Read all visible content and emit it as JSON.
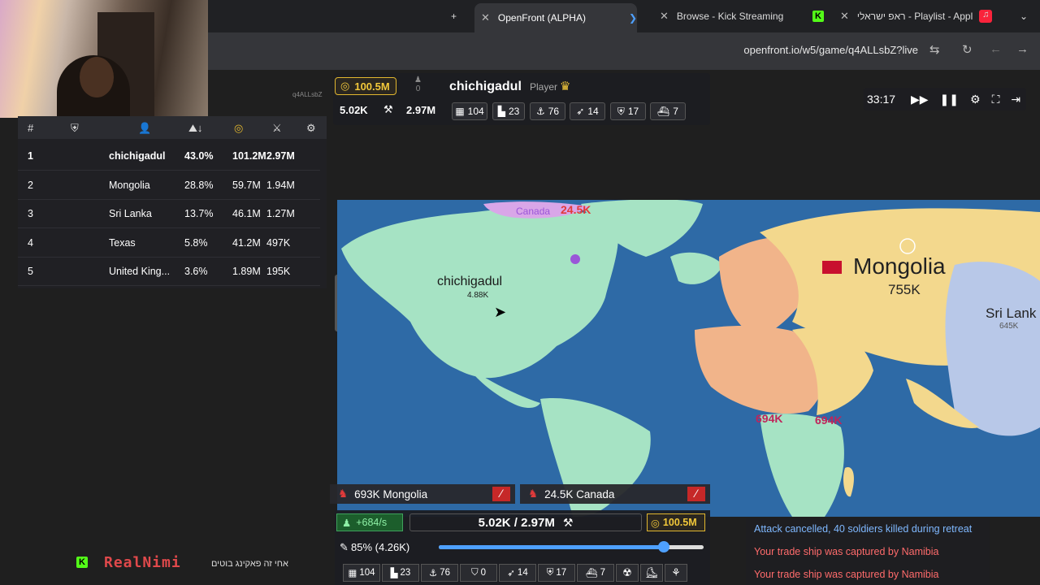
{
  "browser": {
    "tabs": [
      {
        "title": "OpenFront (ALPHA)"
      },
      {
        "title": "Browse - Kick Streaming"
      },
      {
        "title": "ראפ ישראלי - Playlist - Appl"
      }
    ],
    "url": "openfront.io/w5/game/q4ALLsbZ?live"
  },
  "game_id": "q4ALLsbZ",
  "player": {
    "name": "chichigadul",
    "role": "Player",
    "gold": "100.5M",
    "troops": "5.02K",
    "workers": "2.97M",
    "alliances": "0",
    "stats": [
      {
        "icon": "city-icon",
        "value": "104"
      },
      {
        "icon": "factory-icon",
        "value": "23"
      },
      {
        "icon": "port-icon",
        "value": "76"
      },
      {
        "icon": "missile-silo-icon",
        "value": "14"
      },
      {
        "icon": "defense-post-icon",
        "value": "17"
      },
      {
        "icon": "warship-icon",
        "value": "7"
      }
    ]
  },
  "timer": "33:17",
  "leaderboard": {
    "headers": [
      "#",
      "",
      "",
      "",
      "",
      ""
    ],
    "rows": [
      {
        "rank": "1",
        "name": "chichigadul",
        "pct": "43.0%",
        "gold": "101.2M",
        "troops": "2.97M"
      },
      {
        "rank": "2",
        "name": "Mongolia",
        "pct": "28.8%",
        "gold": "59.7M",
        "troops": "1.94M"
      },
      {
        "rank": "3",
        "name": "Sri Lanka",
        "pct": "13.7%",
        "gold": "46.1M",
        "troops": "1.27M"
      },
      {
        "rank": "4",
        "name": "Texas",
        "pct": "5.8%",
        "gold": "41.2M",
        "troops": "497K"
      },
      {
        "rank": "5",
        "name": "United King...",
        "pct": "3.6%",
        "gold": "1.89M",
        "troops": "195K"
      }
    ]
  },
  "map": {
    "labels": {
      "player": "chichigadul",
      "player_troops": "4.88K",
      "mongolia": "Mongolia",
      "mongolia_troops": "755K",
      "srilanka": "Sri Lank",
      "srilanka_troops": "645K",
      "canada": "Canada",
      "canada_troops": "24.5K",
      "africa_a": "694K",
      "africa_b": "694K"
    }
  },
  "attacks": [
    {
      "text": "693K Mongolia"
    },
    {
      "text": "24.5K Canada"
    }
  ],
  "bottom": {
    "rate": "+684/s",
    "troops_ratio": "5.02K / 2.97M",
    "gold": "100.5M",
    "attack_ratio": "85% (4.26K)",
    "slider_fraction": 0.85,
    "build": [
      {
        "icon": "city-icon",
        "value": "104"
      },
      {
        "icon": "factory-icon",
        "value": "23"
      },
      {
        "icon": "port-icon",
        "value": "76"
      },
      {
        "icon": "shield-icon",
        "value": "0"
      },
      {
        "icon": "missile-silo-icon",
        "value": "14"
      },
      {
        "icon": "defense-post-icon",
        "value": "17"
      },
      {
        "icon": "warship-icon",
        "value": "7"
      }
    ]
  },
  "messages": [
    {
      "text": "Attack cancelled, 40 soldiers killed during retreat",
      "color": "#7fb8ff"
    },
    {
      "text": "Your trade ship was captured by Namibia",
      "color": "#ff6b6b"
    },
    {
      "text": "Your trade ship was captured by Namibia",
      "color": "#ff6b6b"
    }
  ],
  "stream": {
    "channel": "RealNimi",
    "hebrew": "אחי זה פאקינג בוטים"
  },
  "colors": {
    "gold": "#e2b72f",
    "ocean": "#2e6aa6",
    "player_land": "#a6e3c4",
    "mongolia_land": "#f3d88d",
    "attack_red": "#e23b3b"
  }
}
